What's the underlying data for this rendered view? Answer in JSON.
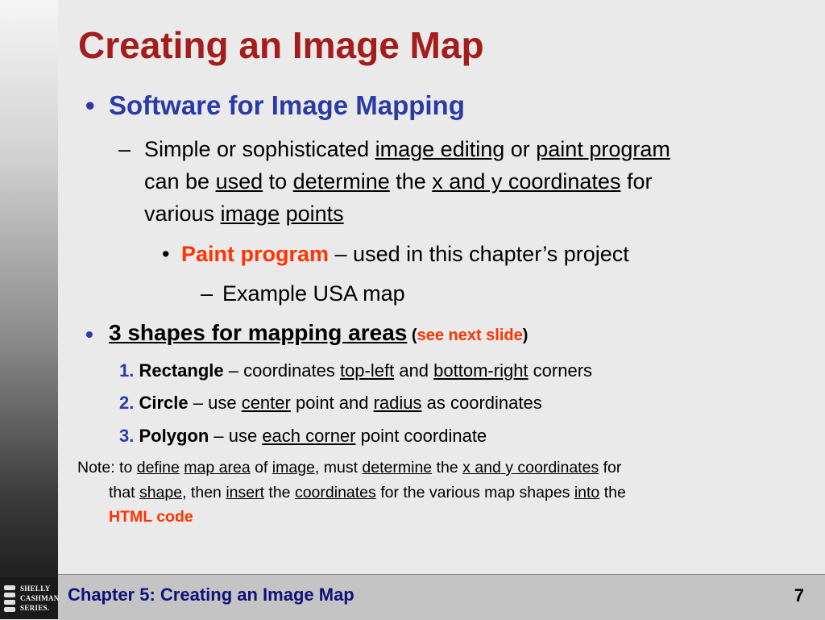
{
  "slide": {
    "title": "Creating an Image Map",
    "footer": "Chapter 5: Creating an Image Map",
    "page_number": "7",
    "logo": {
      "line1": "SHELLY",
      "line2": "CASHMAN",
      "line3": "SERIES."
    }
  },
  "bullets": {
    "b1": {
      "marker": "•",
      "text": "Software for Image Mapping"
    },
    "b1_sub": {
      "marker": "–",
      "l1": {
        "t1": "Simple or sophisticated ",
        "u1": "image editing",
        "t2": " or ",
        "u2": "paint program"
      },
      "l2": {
        "t1": "can be ",
        "u1": "used",
        "t2": " to ",
        "u2": "determine",
        "t3": " the ",
        "u3": "x and y coordinates",
        "t4": " for"
      },
      "l3": {
        "t1": "various ",
        "u1": "image",
        "t2": " ",
        "u2": "points"
      }
    },
    "b1_sub_sub": {
      "marker": "•",
      "highlight": "Paint program",
      "text": " – used in this chapter’s project"
    },
    "b1_sub_sub_sub": {
      "marker": "–",
      "text": "Example USA map"
    },
    "b2": {
      "marker": "•",
      "text": "3 shapes for mapping areas",
      "paren_open": " (",
      "link": "see next slide",
      "paren_close": ")"
    },
    "numbered": [
      {
        "num": "1.",
        "name": "Rectangle",
        "t1": " – coordinates ",
        "u1": "top-left",
        "t2": " and ",
        "u2": "bottom-right",
        "t3": " corners"
      },
      {
        "num": "2.",
        "name": "Circle",
        "t1": " – use ",
        "u1": "center",
        "t2": " point and ",
        "u2": "radius",
        "t3": " as coordinates"
      },
      {
        "num": "3.",
        "name": "Polygon",
        "t1": " – use ",
        "u1": "each corner",
        "t2": " point coordinate"
      }
    ]
  },
  "note": {
    "l1": {
      "t1": "Note: to ",
      "u1": "define",
      "t2": " ",
      "u2": "map area",
      "t3": " of ",
      "u3": "image",
      "t4": ", must ",
      "u4": "determine",
      "t5": " the ",
      "u5": "x and y coordinates",
      "t6": " for"
    },
    "l2": {
      "t1": "that ",
      "u1": "shape",
      "t2": ", then ",
      "u2": "insert",
      "t3": " the ",
      "u3": "coordinates",
      "t4": " for the various map shapes ",
      "u4": "into",
      "t5": " the"
    },
    "l3": {
      "highlight": "HTML code"
    }
  },
  "colors": {
    "title": "#a51c1c",
    "heading_blue": "#2b3ba5",
    "accent_red": "#ff3300",
    "footer_text": "#10107a"
  }
}
